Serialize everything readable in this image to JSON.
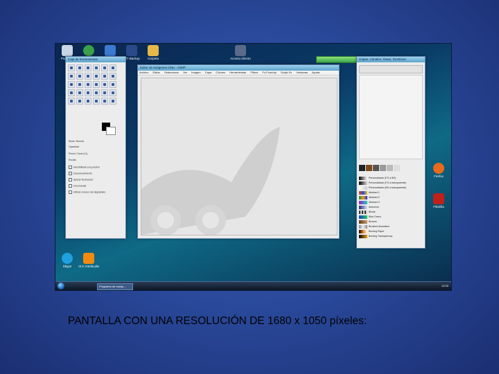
{
  "caption": "PANTALLA CON UNA RESOLUCIÓN DE 1680 x 1050 píxeles:",
  "screenshot": {
    "desktop_icons": [
      {
        "label": "Papelera",
        "icon": "recycle-bin-icon",
        "color": "#c9d6e6"
      },
      {
        "label": "Internet",
        "icon": "ie-icon",
        "color": "#3aa04a"
      },
      {
        "label": "Equipo",
        "icon": "computer-icon",
        "color": "#3a7ad0"
      },
      {
        "label": "NTI Backup",
        "icon": "nti-icon",
        "color": "#2a4a8a"
      },
      {
        "label": "Carpeta",
        "icon": "folder-icon",
        "color": "#e6b84a"
      },
      {
        "label": "Acceso directo",
        "icon": "shortcut-icon",
        "color": "#5a6a8a"
      },
      {
        "label": "Skype",
        "icon": "skype-icon",
        "color": "#1fa0e0"
      },
      {
        "label": "VLC media player",
        "icon": "vlc-icon",
        "color": "#f08a10"
      },
      {
        "label": "FileZilla",
        "icon": "filezilla-icon",
        "color": "#c0201a"
      },
      {
        "label": "Firefox",
        "icon": "firefox-icon",
        "color": "#e86a1a"
      }
    ],
    "toolbox": {
      "title": "Caja de herramientas",
      "options": [
        "Modo: Normal",
        "Opacidad",
        "Pincel: Circle (11)",
        "Escala",
        "Sensibilidad a la presión",
        "Desvanecimiento",
        "Aplicar fluctuación",
        "Incremental",
        "Utilizar colores del degradado"
      ]
    },
    "main_window": {
      "title": "Editor de Imágenes GNU - GIMP",
      "menu": [
        "Archivo",
        "Editar",
        "Seleccionar",
        "Ver",
        "Imagen",
        "Capa",
        "Colores",
        "Herramientas",
        "Filtros",
        "Fx-Foundry",
        "Script-Fu",
        "Ventanas",
        "Ayuda"
      ]
    },
    "layers_window": {
      "title": "Capas, Canales, Rutas, Deshacer",
      "gradients": [
        "Personalizado (FG a BG)",
        "Personalizado (FG a transparente)",
        "Personalizado (BG a transparente)",
        "Abstract 1",
        "Abstract 2",
        "Abstract 3",
        "Aneurism",
        "Blinds",
        "Blue Green",
        "Browns",
        "Brushed Aluminium",
        "Burning Paper",
        "Burning Transparency"
      ]
    },
    "taskbar": {
      "task_label": "Programa de manip...",
      "clock": "12:00"
    }
  }
}
